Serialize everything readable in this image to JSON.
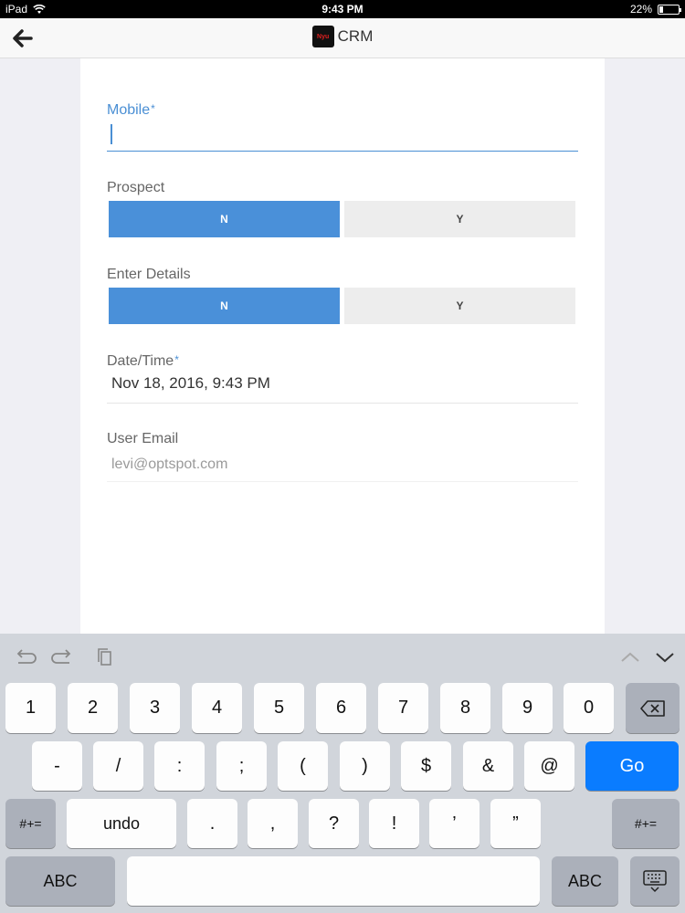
{
  "status_bar": {
    "device": "iPad",
    "time": "9:43 PM",
    "battery": "22%",
    "battery_level": 0.22
  },
  "nav": {
    "title": "CRM",
    "logo_text": "Nyu"
  },
  "form": {
    "mobile": {
      "label": "Mobile",
      "required_mark": "*",
      "value": ""
    },
    "prospect": {
      "label": "Prospect",
      "options": [
        "N",
        "Y"
      ],
      "selected": "N"
    },
    "enter_details": {
      "label": "Enter Details",
      "options": [
        "N",
        "Y"
      ],
      "selected": "N"
    },
    "datetime": {
      "label": "Date/Time",
      "required_mark": "*",
      "value": "Nov 18, 2016, 9:43 PM"
    },
    "user_email": {
      "label": "User Email",
      "value": "levi@optspot.com"
    }
  },
  "keyboard": {
    "row1": [
      "1",
      "2",
      "3",
      "4",
      "5",
      "6",
      "7",
      "8",
      "9",
      "0"
    ],
    "row2": [
      "-",
      "/",
      ":",
      ";",
      "(",
      ")",
      "$",
      "&",
      "@"
    ],
    "go": "Go",
    "row3_left": "#+=",
    "undo": "undo",
    "row3": [
      ".",
      ",",
      "?",
      "!",
      "’",
      "”"
    ],
    "row3_right": "#+=",
    "abc_left": "ABC",
    "abc_right": "ABC"
  },
  "colors": {
    "accent": "#4a90d9",
    "go": "#0a7cff"
  }
}
